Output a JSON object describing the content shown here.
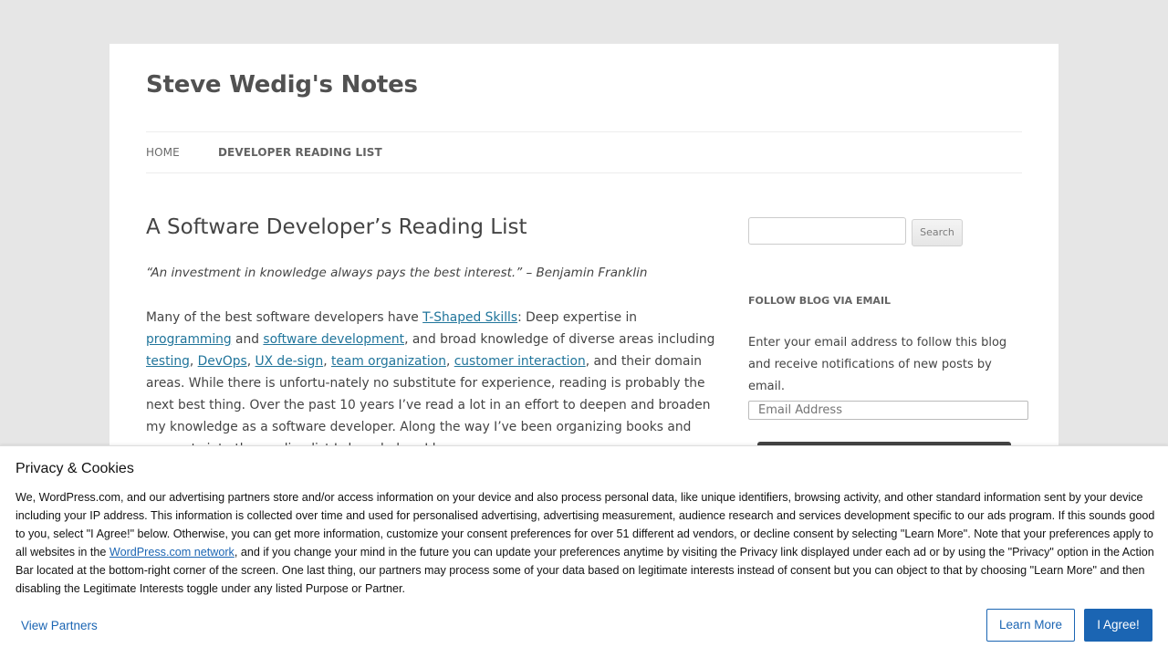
{
  "site": {
    "title": "Steve Wedig's Notes"
  },
  "nav": {
    "items": [
      {
        "label": "Home"
      },
      {
        "label": "Developer Reading List"
      }
    ]
  },
  "post": {
    "title": "A Software Developer’s Reading List",
    "quote": "“An investment in knowledge always pays the best interest.” – Benjamin Franklin",
    "p1": {
      "t1": "Many of the best software developers have ",
      "link_tshaped": "T-Shaped Skills",
      "t2": ": Deep expertise in ",
      "link_programming": "programming",
      "t3": " and ",
      "link_software_dev": "software development",
      "t4": ", and broad knowledge of diverse areas including ",
      "link_testing": "testing",
      "sep1": ", ",
      "link_devops": "DevOps",
      "sep2": ", ",
      "link_uxdesign": "UX de-sign",
      "sep3": ", ",
      "link_team_org": "team organization",
      "sep4": ", ",
      "link_customer": "customer interaction",
      "t5": ", and their domain areas. While there is unfortu-nately no substitute for experience, reading is probably the next best thing. Over the past 10 years I’ve read a lot in an effort to deepen and broaden my knowledge as a software developer. Along the way I’ve been organizing books and concepts into the reading list I share below. I have"
    }
  },
  "sidebar": {
    "search": {
      "placeholder": "",
      "button_label": "Search"
    },
    "follow": {
      "title": "Follow Blog via Email",
      "description": "Enter your email address to follow this blog and receive notifications of new posts by email.",
      "email_placeholder": "Email Address"
    }
  },
  "consent": {
    "title": "Privacy & Cookies",
    "text_before_link": "We, WordPress.com, and our advertising partners store and/or access information on your device and also process personal data, like unique identifiers, browsing activity, and other standard information sent by your device including your IP address. This information is collected over time and used for personalised advertising, advertising measurement, audience research and services development specific to our ads program. If this sounds good to you, select \"I Agree!\" below. Otherwise, you can get more information, customize your consent preferences for over 51 different ad vendors, or decline consent by selecting \"Learn More\". Note that your preferences apply to all websites in the ",
    "link_label": "WordPress.com network",
    "text_after_link": ", and if you change your mind in the future you can update your preferences anytime by visiting the Privacy link displayed under each ad or by using the \"Privacy\" option in the Action Bar located at the bottom-right corner of the screen. One last thing, our partners may process some of your data based on legitimate interests instead of consent but you can object to that by choosing \"Learn More\" and then disabling the Legitimate Interests toggle under any listed Purpose or Partner.",
    "view_partners_label": "View Partners",
    "learn_more_label": "Learn More",
    "agree_label": "I Agree!"
  },
  "colors": {
    "link": "#21759b",
    "consent_accent": "#1b65b3",
    "page_background": "#e6e6e6"
  }
}
